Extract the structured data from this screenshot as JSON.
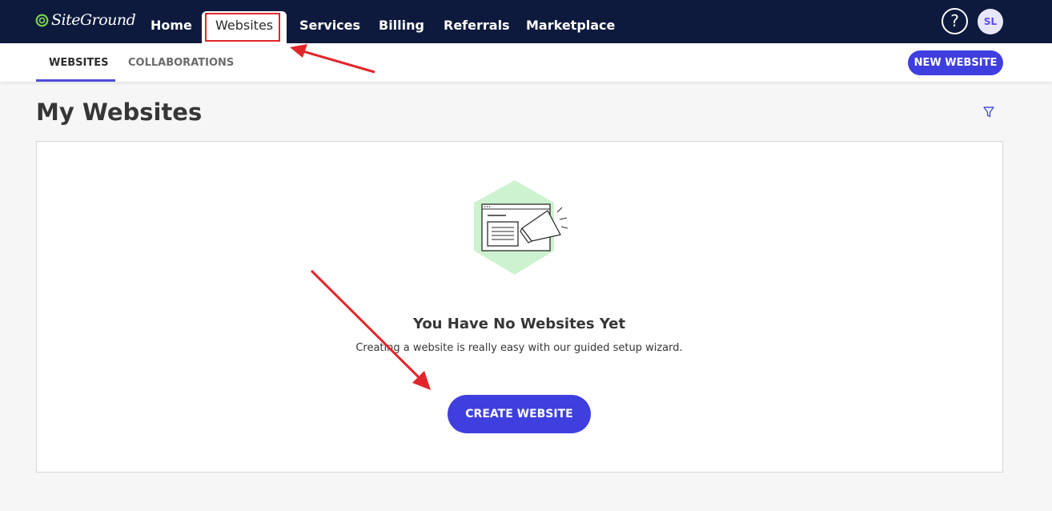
{
  "brand": {
    "name": "SiteGround",
    "accent": "#3f3fe0",
    "nav_bg": "#0e1a3d",
    "highlight": "#e2262b"
  },
  "nav": {
    "items": [
      {
        "label": "Home"
      },
      {
        "label": "Websites"
      },
      {
        "label": "Services"
      },
      {
        "label": "Billing"
      },
      {
        "label": "Referrals"
      },
      {
        "label": "Marketplace"
      }
    ],
    "active": "Websites",
    "help_icon": "question-circle-icon",
    "help_label": "?",
    "avatar_initials": "SL"
  },
  "subnav": {
    "tabs": [
      {
        "label": "WEBSITES"
      },
      {
        "label": "COLLABORATIONS"
      }
    ],
    "active": "WEBSITES",
    "new_button": "NEW WEBSITE"
  },
  "main": {
    "title": "My Websites",
    "filter_icon": "filter-icon",
    "empty_state": {
      "illustration": "browser-megaphone-illustration",
      "title": "You Have No Websites Yet",
      "description": "Creating a website is really easy with our guided setup wizard.",
      "cta": "CREATE WEBSITE"
    }
  }
}
